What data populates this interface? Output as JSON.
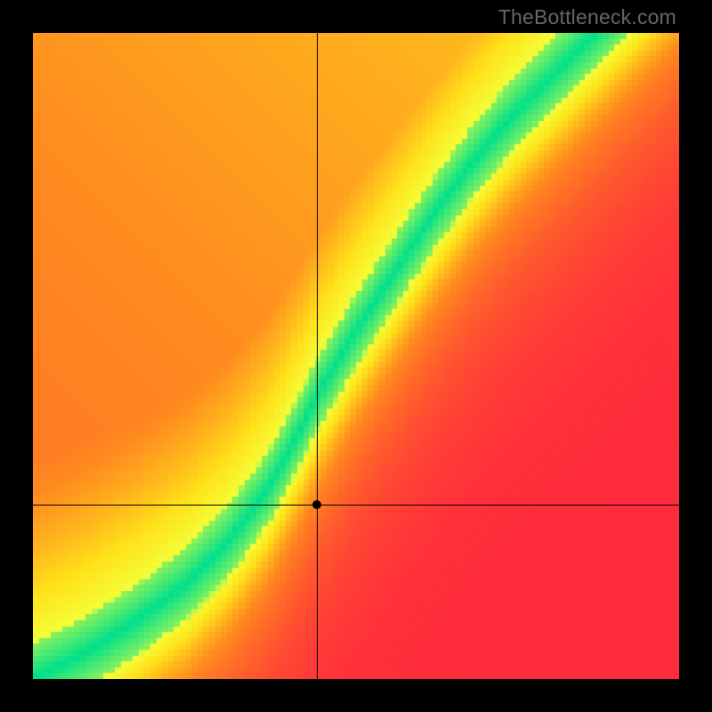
{
  "watermark": "TheBottleneck.com",
  "chart_data": {
    "type": "heatmap",
    "title": "",
    "xlabel": "",
    "ylabel": "",
    "xlim": [
      0,
      1
    ],
    "ylim": [
      0,
      1
    ],
    "grid": false,
    "legend": false,
    "marker": {
      "x": 0.44,
      "y": 0.27
    },
    "crosshair": {
      "x": 0.44,
      "y": 0.27
    },
    "optimal_curve": {
      "description": "Green band indicating balanced GPU/CPU pairing; lower-left fan to upper-right diagonal",
      "points": [
        [
          0.0,
          0.0
        ],
        [
          0.08,
          0.04
        ],
        [
          0.16,
          0.09
        ],
        [
          0.24,
          0.15
        ],
        [
          0.3,
          0.21
        ],
        [
          0.36,
          0.29
        ],
        [
          0.4,
          0.36
        ],
        [
          0.44,
          0.44
        ],
        [
          0.5,
          0.54
        ],
        [
          0.56,
          0.63
        ],
        [
          0.62,
          0.72
        ],
        [
          0.68,
          0.8
        ],
        [
          0.74,
          0.87
        ],
        [
          0.8,
          0.93
        ],
        [
          0.86,
          0.99
        ]
      ],
      "band_halfwidth": 0.055
    },
    "color_stops": [
      {
        "t": 0.0,
        "color": "#ff2a3c"
      },
      {
        "t": 0.45,
        "color": "#ff8a1f"
      },
      {
        "t": 0.7,
        "color": "#ffe21a"
      },
      {
        "t": 0.86,
        "color": "#f4ff3a"
      },
      {
        "t": 1.0,
        "color": "#00e08c"
      }
    ],
    "background_gradient": {
      "top_right": "#ffe21a",
      "bottom_left": "#ff2a3c",
      "steepness_left_of_band": 2.2,
      "steepness_right_of_band": 0.9
    }
  }
}
